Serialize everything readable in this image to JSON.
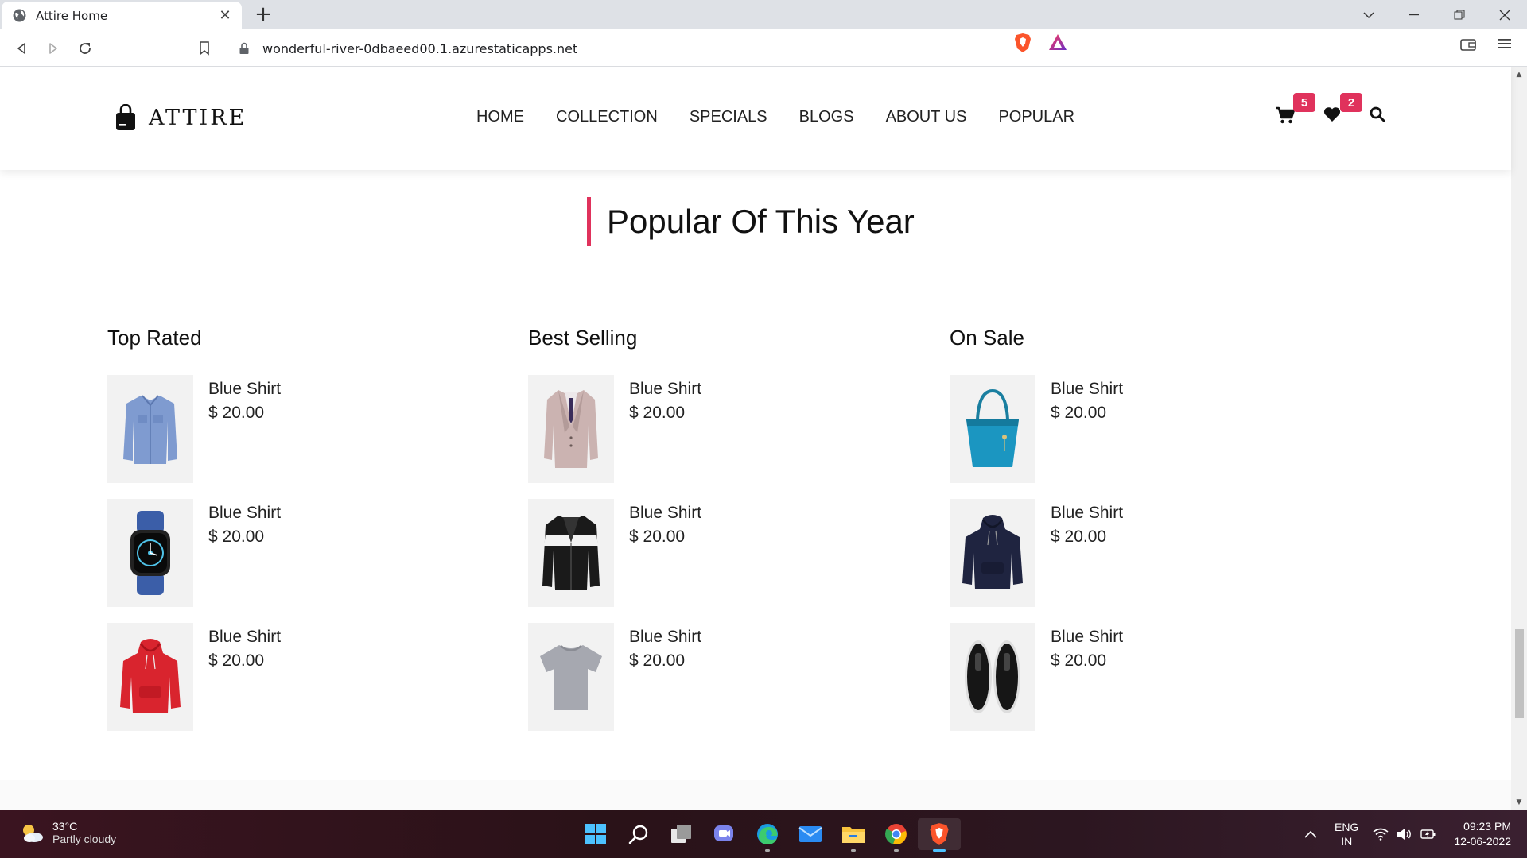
{
  "browser": {
    "tab_title": "Attire Home",
    "tab_close": "✕",
    "new_tab": "+",
    "url": "wonderful-river-0dbaeed00.1.azurestaticapps.net"
  },
  "site": {
    "logo_text": "ATTIRE",
    "nav": [
      "HOME",
      "COLLECTION",
      "SPECIALS",
      "BLOGS",
      "ABOUT US",
      "POPULAR"
    ],
    "cart_count": "5",
    "wishlist_count": "2",
    "accent_color": "#e0325c"
  },
  "section": {
    "title": "Popular Of This Year"
  },
  "columns": [
    {
      "heading": "Top Rated",
      "products": [
        {
          "name": "Blue Shirt",
          "price": "$ 20.00",
          "image": "blue-shirt"
        },
        {
          "name": "Blue Shirt",
          "price": "$ 20.00",
          "image": "smart-watch"
        },
        {
          "name": "Blue Shirt",
          "price": "$ 20.00",
          "image": "red-hoodie"
        }
      ]
    },
    {
      "heading": "Best Selling",
      "products": [
        {
          "name": "Blue Shirt",
          "price": "$ 20.00",
          "image": "suit"
        },
        {
          "name": "Blue Shirt",
          "price": "$ 20.00",
          "image": "black-jacket"
        },
        {
          "name": "Blue Shirt",
          "price": "$ 20.00",
          "image": "grey-tshirt"
        }
      ]
    },
    {
      "heading": "On Sale",
      "products": [
        {
          "name": "Blue Shirt",
          "price": "$ 20.00",
          "image": "teal-handbag"
        },
        {
          "name": "Blue Shirt",
          "price": "$ 20.00",
          "image": "navy-hoodie"
        },
        {
          "name": "Blue Shirt",
          "price": "$ 20.00",
          "image": "black-sneakers"
        }
      ]
    }
  ],
  "taskbar": {
    "temperature": "33°C",
    "weather": "Partly cloudy",
    "lang_top": "ENG",
    "lang_bottom": "IN",
    "time": "09:23 PM",
    "date": "12-06-2022"
  }
}
